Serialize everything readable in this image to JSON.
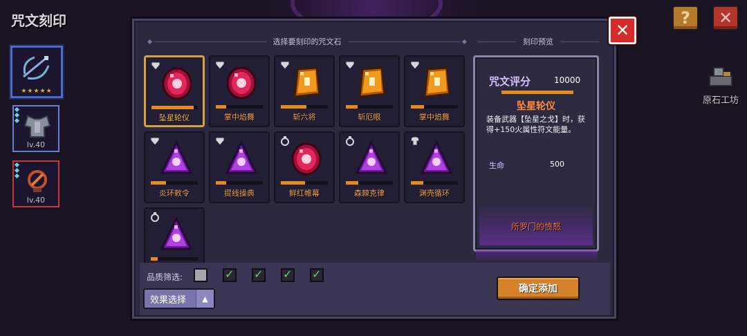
{
  "screen": {
    "title": "咒文刻印"
  },
  "top_buttons": {
    "help": "?",
    "close": "✕"
  },
  "left_slots": [
    {
      "level": "",
      "stars": "★★★★★",
      "selected": true,
      "color": "#4a6cd0"
    },
    {
      "level": "lv.40",
      "stars": "",
      "selected": false,
      "color": "#6a7fd0"
    },
    {
      "level": "lv.40",
      "stars": "",
      "selected": false,
      "color": "#c23a3a"
    }
  ],
  "workshop": {
    "label": "原石工坊",
    "icon": "forge-icon"
  },
  "panel": {
    "left_header": "选择要刻印的咒文石",
    "right_header": "刻印预览",
    "close_label": "✕"
  },
  "runes": [
    {
      "name": "坠星轮仪",
      "gem": "red-round",
      "slot": "shield",
      "progress": 0.92,
      "selected": true
    },
    {
      "name": "掌中焰舞",
      "gem": "red-round",
      "slot": "shield",
      "progress": 0.22,
      "selected": false
    },
    {
      "name": "斩六将",
      "gem": "orange-square",
      "slot": "shield",
      "progress": 0.55,
      "selected": false
    },
    {
      "name": "斩厄眼",
      "gem": "orange-square",
      "slot": "shield",
      "progress": 0.25,
      "selected": false
    },
    {
      "name": "掌中焰舞",
      "gem": "orange-square",
      "slot": "shield",
      "progress": 0.28,
      "selected": false
    },
    {
      "name": "炎环敕令",
      "gem": "purple-triangle",
      "slot": "shield",
      "progress": 0.32,
      "selected": false
    },
    {
      "name": "提线操典",
      "gem": "purple-triangle",
      "slot": "shield",
      "progress": 0.22,
      "selected": false
    },
    {
      "name": "鲜红帷幕",
      "gem": "red-round",
      "slot": "ring",
      "progress": 0.52,
      "selected": false
    },
    {
      "name": "森棘克律",
      "gem": "purple-triangle",
      "slot": "ring",
      "progress": 0.26,
      "selected": false
    },
    {
      "name": "渊壳循环",
      "gem": "purple-triangle",
      "slot": "armor",
      "progress": 0.26,
      "selected": false
    },
    {
      "name": "",
      "gem": "purple-triangle",
      "slot": "ring",
      "progress": 0.15,
      "selected": false
    }
  ],
  "filter": {
    "label": "品质筛选:",
    "checks": [
      {
        "checked": false,
        "color": "#a7a4ad"
      },
      {
        "checked": true,
        "color": "#3a8a4a"
      },
      {
        "checked": true,
        "color": "#3a5a8a"
      },
      {
        "checked": true,
        "color": "#8a3a8a"
      },
      {
        "checked": true,
        "color": "#8a6a2a"
      }
    ],
    "effect_button": "效果选择",
    "effect_arrow": "▲"
  },
  "confirm_button": "确定添加",
  "preview": {
    "score_label": "咒文评分",
    "score_value": "10000",
    "rune_name": "坠星轮仪",
    "description": "装备武器【坠星之戈】时，获得+150火属性符文能量。",
    "stat_label": "生命",
    "stat_value": "500",
    "set_name": "所罗门的愤怒"
  },
  "colors": {
    "accent_orange": "#e58a1e",
    "panel_bg": "#2c2840",
    "rune_name": "#f0a050",
    "title_purple": "#d6c2ff"
  }
}
